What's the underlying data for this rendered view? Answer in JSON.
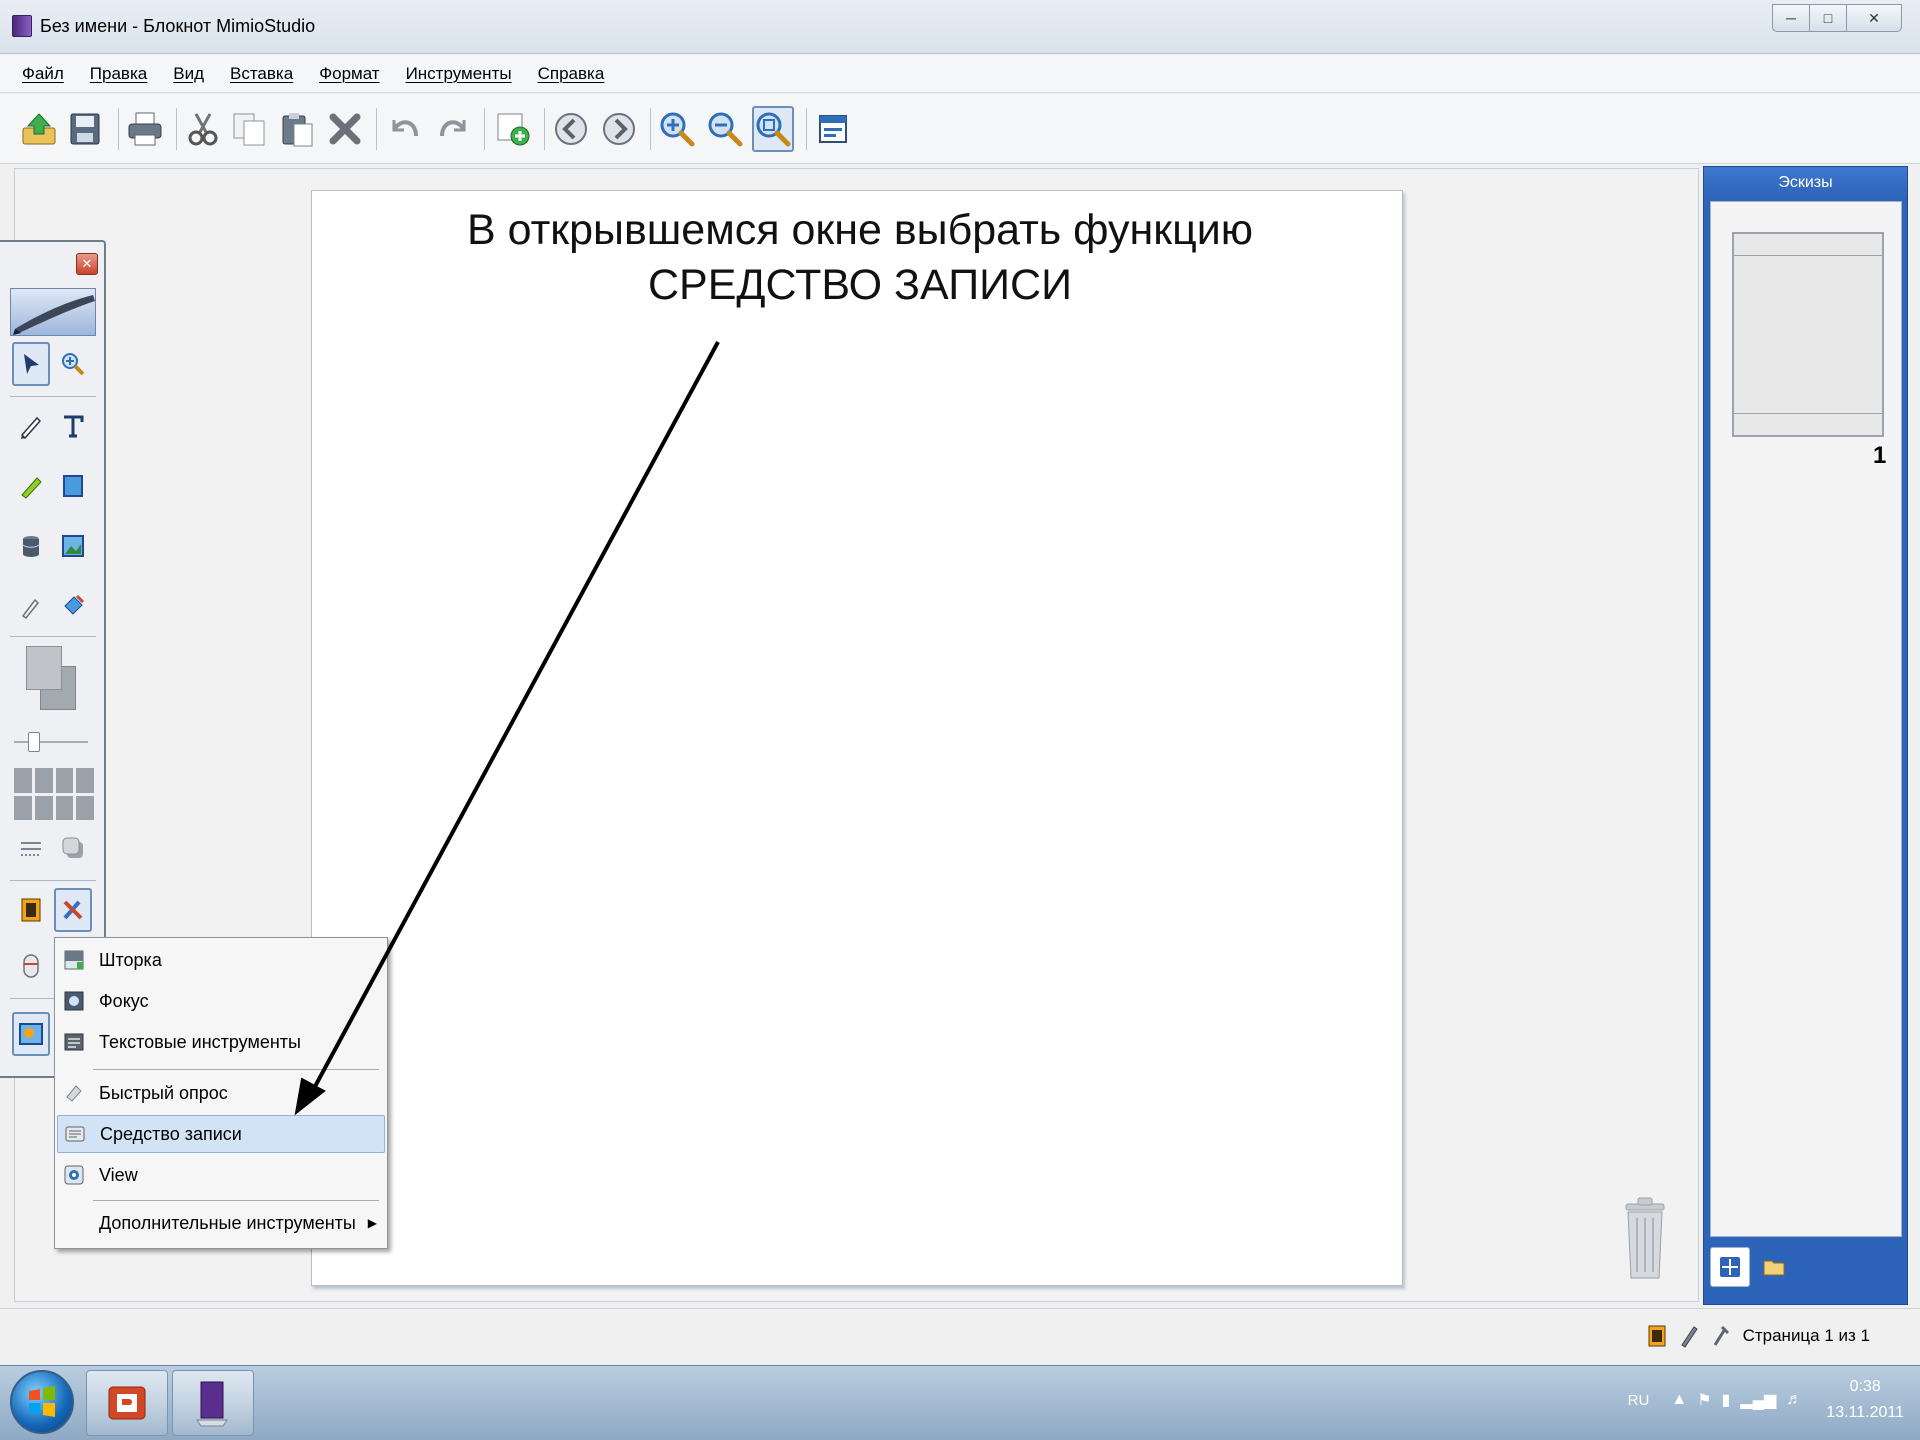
{
  "window": {
    "title": "Без имени - Блокнот MimioStudio",
    "controls": [
      "minimize-icon",
      "maximize-icon",
      "close-icon"
    ]
  },
  "menu": {
    "items": [
      {
        "label": "Файл"
      },
      {
        "label": "Правка"
      },
      {
        "label": "Вид"
      },
      {
        "label": "Вставка"
      },
      {
        "label": "Формат"
      },
      {
        "label": "Инструменты"
      },
      {
        "label": "Справка"
      }
    ]
  },
  "toolbar": {
    "icons": [
      "open-icon",
      "save-icon",
      "print-icon",
      "cut-icon",
      "copy-icon",
      "paste-icon",
      "delete-icon",
      "undo-icon",
      "redo-icon",
      "new-page-icon",
      "previous-page-icon",
      "next-page-icon",
      "zoom-in-icon",
      "zoom-out-icon",
      "fit-page-icon",
      "display-settings-icon"
    ],
    "active": "fit-page-icon"
  },
  "canvas": {
    "instruction_line1": "В открывшемся окне выбрать функцию",
    "instruction_line2": "СРЕДСТВО ЗАПИСИ"
  },
  "thumbnails": {
    "title": "Эскизы",
    "pages": [
      {
        "number": "1"
      }
    ]
  },
  "context_menu": {
    "items": [
      {
        "label": "Шторка",
        "icon": "screen-shade-icon"
      },
      {
        "label": "Фокус",
        "icon": "spotlight-icon"
      },
      {
        "label": "Текстовые инструменты",
        "icon": "text-tools-icon"
      },
      {
        "label": "Быстрый опрос",
        "icon": "quick-poll-icon"
      },
      {
        "label": "Средство записи",
        "icon": "recorder-icon",
        "selected": true
      },
      {
        "label": "View",
        "icon": "view-icon"
      },
      {
        "label": "Дополнительные инструменты",
        "icon": "",
        "submenu": true
      }
    ]
  },
  "statusbar": {
    "page_label": "Страница 1 из 1"
  },
  "taskbar": {
    "language": "RU",
    "time": "0:38",
    "date": "13.11.2011"
  },
  "colors": {
    "panel_blue": "#2d63b8",
    "selection": "#d3e3f6",
    "arrow": "#000000"
  }
}
